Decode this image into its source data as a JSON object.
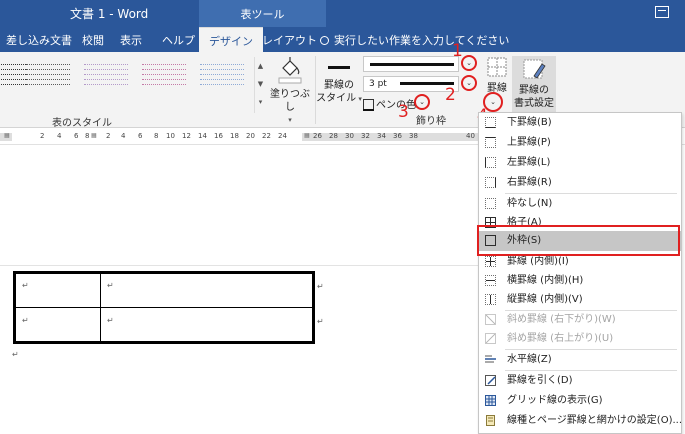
{
  "window": {
    "title": "文書 1  -  Word",
    "context_tab": "表ツール"
  },
  "tabs": [
    {
      "label": "差し込み文書"
    },
    {
      "label": "校閲"
    },
    {
      "label": "表示"
    },
    {
      "label": "ヘルプ"
    },
    {
      "label": "デザイン"
    },
    {
      "label": "レイアウト"
    }
  ],
  "tellme": {
    "placeholder": "実行したい作業を入力してください"
  },
  "ribbon": {
    "shading_label": "塗りつぶし",
    "table_styles_group": "表のスタイル",
    "border_styles_label_1": "罫線の",
    "border_styles_label_2": "スタイル",
    "pen_weight": "3 pt",
    "pen_color_label": "ペンの色",
    "borders_group": "飾り枠",
    "borders_button": "罫線",
    "border_painter_1": "罫線の",
    "border_painter_2": "書式設定"
  },
  "annotations": [
    "1",
    "2",
    "3",
    "4"
  ],
  "ruler_numbers": [
    "2",
    "4",
    "6",
    "8",
    "2",
    "4",
    "6",
    "8",
    "10",
    "12",
    "14",
    "16",
    "18",
    "20",
    "22",
    "24",
    "26",
    "28",
    "30",
    "32",
    "34",
    "36",
    "38",
    "40"
  ],
  "document": {
    "paragraph_mark": "↵"
  },
  "borders_menu": {
    "items": [
      {
        "label": "下罫線(B)",
        "icon": "bottom-border-icon",
        "enabled": true
      },
      {
        "label": "上罫線(P)",
        "icon": "top-border-icon",
        "enabled": true
      },
      {
        "label": "左罫線(L)",
        "icon": "left-border-icon",
        "enabled": true
      },
      {
        "label": "右罫線(R)",
        "icon": "right-border-icon",
        "enabled": true
      },
      {
        "label": "枠なし(N)",
        "icon": "no-border-icon",
        "enabled": true
      },
      {
        "label": "格子(A)",
        "icon": "all-borders-icon",
        "enabled": true
      },
      {
        "label": "外枠(S)",
        "icon": "outside-borders-icon",
        "enabled": true,
        "selected": true
      },
      {
        "label": "罫線 (内側)(I)",
        "icon": "inside-borders-icon",
        "enabled": true
      },
      {
        "label": "横罫線 (内側)(H)",
        "icon": "inside-horizontal-border-icon",
        "enabled": true
      },
      {
        "label": "縦罫線 (内側)(V)",
        "icon": "inside-vertical-border-icon",
        "enabled": true
      },
      {
        "label": "斜め罫線 (右下がり)(W)",
        "icon": "diagonal-down-border-icon",
        "enabled": false
      },
      {
        "label": "斜め罫線 (右上がり)(U)",
        "icon": "diagonal-up-border-icon",
        "enabled": false
      },
      {
        "label": "水平線(Z)",
        "icon": "horizontal-line-icon",
        "enabled": true
      },
      {
        "label": "罫線を引く(D)",
        "icon": "draw-table-icon",
        "enabled": true
      },
      {
        "label": "グリッド線の表示(G)",
        "icon": "view-gridlines-icon",
        "enabled": true
      },
      {
        "label": "線種とページ罫線と網かけの設定(O)...",
        "icon": "borders-and-shading-icon",
        "enabled": true
      }
    ]
  },
  "colors": {
    "word_blue": "#2b579a",
    "highlight_red": "#e02020",
    "selected_item_bg": "#c6c6c6"
  }
}
